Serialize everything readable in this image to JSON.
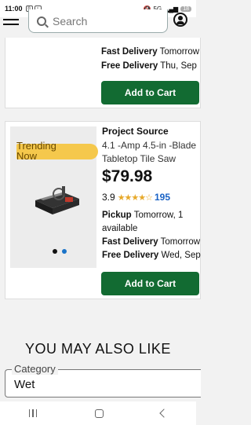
{
  "status_bar": {
    "time": "11:00",
    "network": "5G",
    "battery": "18"
  },
  "header": {
    "search_placeholder": "Search"
  },
  "prev_card": {
    "fast_label": "Fast Delivery",
    "fast_value": "Tomorrow",
    "free_label": "Free Delivery",
    "free_value": "Thu, Sep",
    "cart_label": "Add to Cart"
  },
  "product": {
    "badge": "Trending Now",
    "brand": "Project Source",
    "title_line1": "4.1 -Amp 4.5-in -Blade",
    "title_line2": "Tabletop Tile Saw",
    "price": "$79.98",
    "rating": "3.9",
    "stars": "★★★★☆",
    "reviews": "195",
    "pickup_label": "Pickup",
    "pickup_value": "Tomorrow, 1",
    "pickup_value2": "available",
    "fast_label": "Fast Delivery",
    "fast_value": "Tomorrow",
    "free_label": "Free Delivery",
    "free_value": "Wed, Sep",
    "cart_label": "Add to Cart",
    "image_count": 2,
    "active_image": 2
  },
  "section": {
    "title": "YOU MAY ALSO LIKE"
  },
  "filter": {
    "legend": "Category",
    "value": "Wet"
  },
  "colors": {
    "accent": "#126b32",
    "badge": "#f5c84c",
    "link": "#1a62c5",
    "stars": "#e7a92a"
  }
}
